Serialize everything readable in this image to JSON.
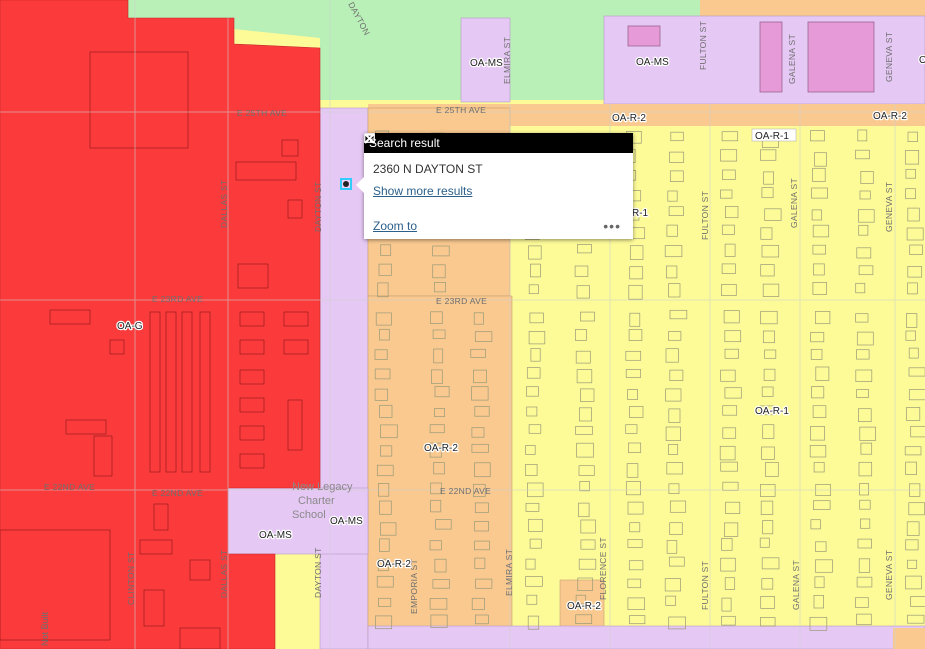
{
  "popup": {
    "title": "Search result",
    "address": "2360 N DAYTON ST",
    "show_more": "Show more results",
    "zoom_to": "Zoom to",
    "more_dots": "•••"
  },
  "zone_labels": {
    "oa_g": "OA-G",
    "oa_ms_top1": "OA-MS",
    "oa_ms_top2": "OA-MS",
    "oa_ms_school": "OA-MS",
    "oa_ms_lower": "OA-MS",
    "oa_r2_top1": "OA-R-2",
    "oa_r2_top2": "OA-R-2",
    "oa_r2_mid": "OA-R-2",
    "oa_r2_bottom1": "OA-R-2",
    "oa_r2_bottom2": "OA-R-2",
    "oa_r1_top": "OA-R-1",
    "oa_r1_partial": "R-1",
    "oa_r1_mid": "OA-R-1",
    "oa_partial_right": "O"
  },
  "streets": {
    "e25_left": "E 25TH AVE",
    "e25_right": "E 25TH AVE",
    "e23_left": "E 23RD AVE",
    "e23_right": "E 23RD AVE",
    "e22_far": "E 22ND AVE",
    "e22_left": "E 22ND AVE",
    "e22_right": "E 22ND AVE",
    "dayton_top": "DAYTON",
    "dayton_mid": "DAYTON ST",
    "dayton_bottom": "DAYTON ST",
    "dallas_mid": "DALLAS ST",
    "dallas_bottom": "DALLAS ST",
    "clinton": "CLINTON ST",
    "elmira_top": "ELMIRA ST",
    "elmira_bottom": "ELMIRA ST",
    "emporia": "EMPORIA ST",
    "florence": "FLORENCE ST",
    "fulton_top": "FULTON ST",
    "fulton_mid": "FULTON ST",
    "fulton_bottom": "FULTON ST",
    "galena_top": "GALENA ST",
    "galena_mid": "GALENA ST",
    "galena_bottom": "GALENA ST",
    "geneva_top": "GENEVA ST",
    "geneva_mid": "GENEVA ST",
    "geneva_bottom": "GENEVA ST"
  },
  "school": {
    "line1": "New Legacy",
    "line2": "Charter",
    "line3": "School"
  },
  "other_text": {
    "not_built": "Not Built"
  },
  "colors": {
    "red": "#fb3b3b",
    "yellow": "#fdfb98",
    "orange": "#f9c98f",
    "lavender": "#e6c8f5",
    "green": "#b9f0b8",
    "pink_bldg": "#e79ad8"
  }
}
